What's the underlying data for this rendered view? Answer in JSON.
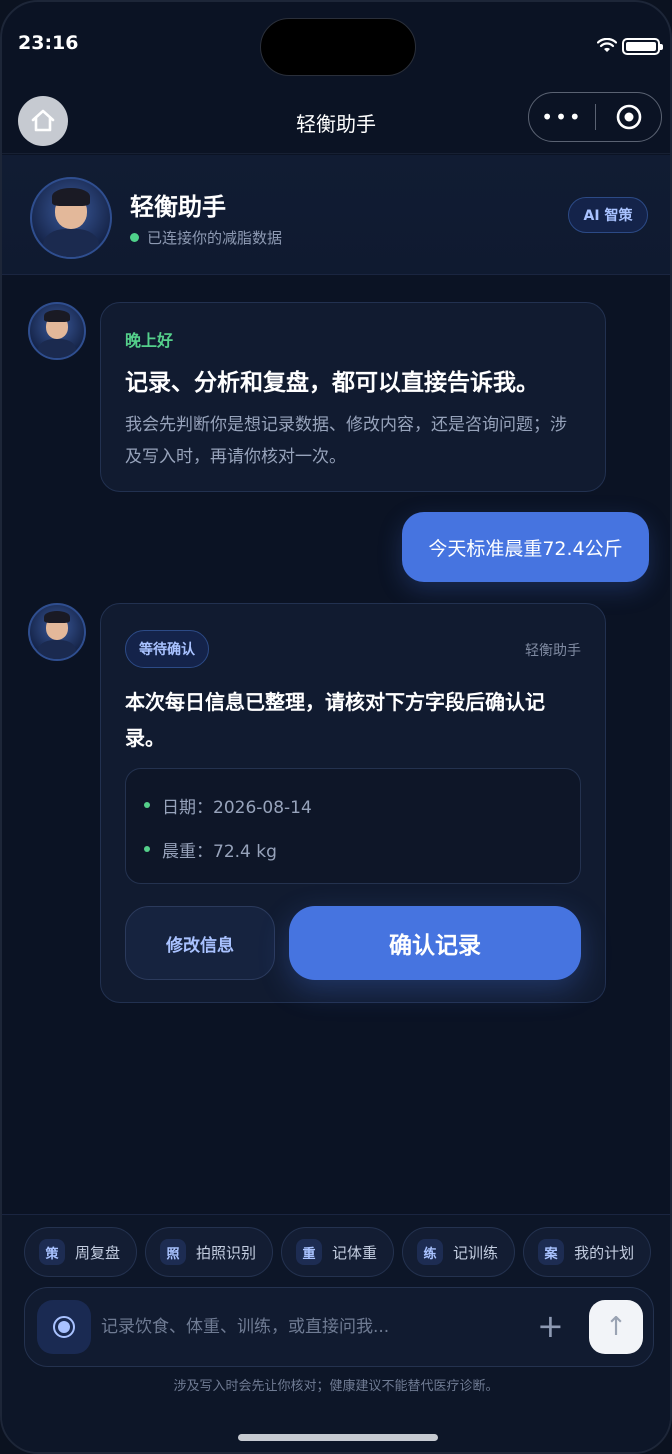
{
  "status_bar": {
    "time": "23:16"
  },
  "navbar": {
    "title": "轻衡助手",
    "more_label": "•••"
  },
  "header": {
    "title": "轻衡助手",
    "status": "已连接你的减脂数据",
    "badge": "AI 智策"
  },
  "messages": {
    "welcome": {
      "greeting": "晚上好",
      "title": "记录、分析和复盘，都可以直接告诉我。",
      "body": "我会先判断你是想记录数据、修改内容，还是咨询问题；涉及写入时，再请你核对一次。"
    },
    "user": {
      "text": "今天标准晨重72.4公斤"
    },
    "confirm": {
      "badge": "等待确认",
      "sender": "轻衡助手",
      "title": "本次每日信息已整理，请核对下方字段后确认记录。",
      "fields": [
        {
          "text": "日期：2026-08-14"
        },
        {
          "text": "晨重：72.4 kg"
        }
      ],
      "edit_label": "修改信息",
      "confirm_label": "确认记录"
    }
  },
  "quick_actions": [
    {
      "icon": "策",
      "label": "周复盘"
    },
    {
      "icon": "照",
      "label": "拍照识别"
    },
    {
      "icon": "重",
      "label": "记体重"
    },
    {
      "icon": "练",
      "label": "记训练"
    },
    {
      "icon": "案",
      "label": "我的计划"
    }
  ],
  "composer": {
    "placeholder": "记录饮食、体重、训练，或直接问我...",
    "value": "",
    "plus": "+",
    "send": "↑"
  },
  "disclaimer": "涉及写入时会先让你核对；健康建议不能替代医疗诊断。",
  "colors": {
    "accent": "#4674e0",
    "online": "#4fd18b",
    "background": "#0b1324"
  }
}
